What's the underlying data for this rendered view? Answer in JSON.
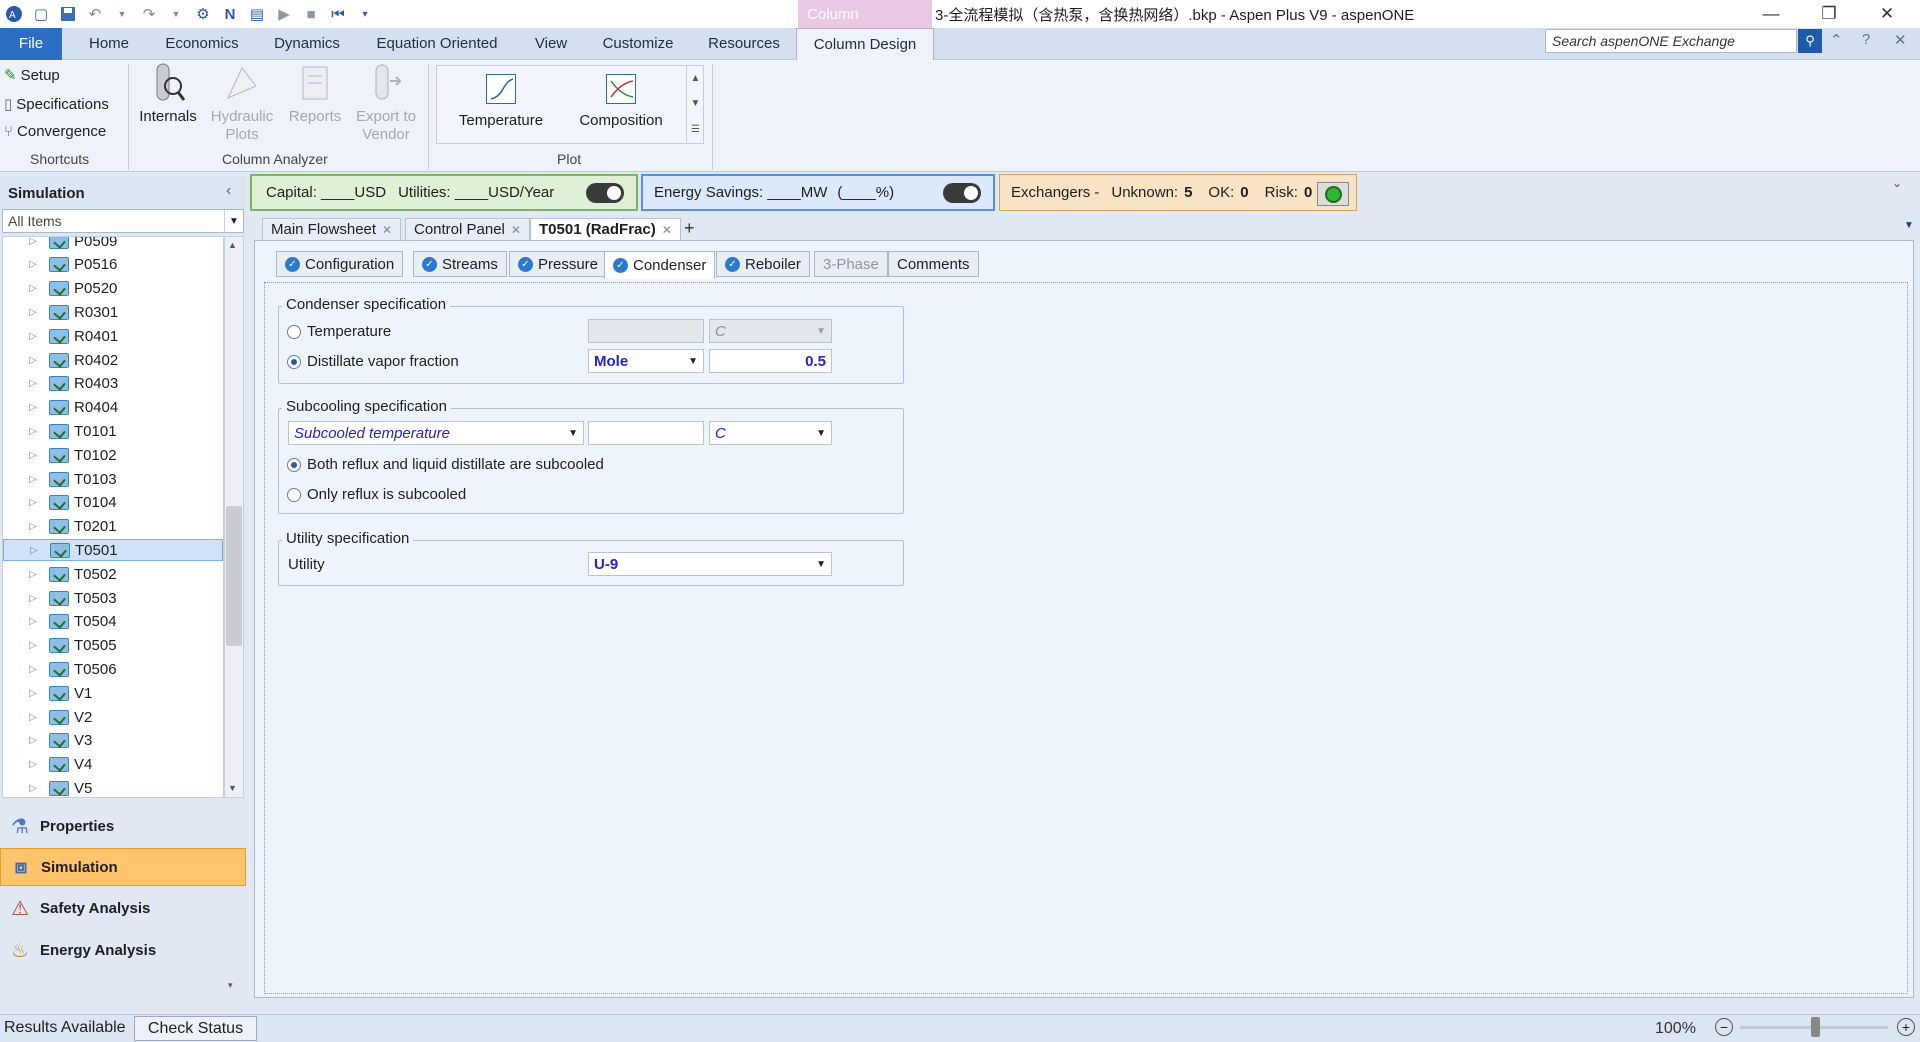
{
  "window": {
    "title": "3-全流程模拟（含热泵，含换热网络）.bkp - Aspen Plus V9 - aspenONE",
    "context_tab_header": "Column"
  },
  "ribbon": {
    "tabs": [
      "File",
      "Home",
      "Economics",
      "Dynamics",
      "Equation Oriented",
      "View",
      "Customize",
      "Resources",
      "Column Design"
    ],
    "active_tab": "Column Design",
    "search_placeholder": "Search aspenONE Exchange",
    "shortcuts": {
      "label": "Shortcuts",
      "items": [
        "Setup",
        "Specifications",
        "Convergence"
      ]
    },
    "column_analyzer": {
      "label": "Column Analyzer",
      "internals": "Internals",
      "hydraulic_plots": [
        "Hydraulic",
        "Plots"
      ],
      "reports": "Reports",
      "export": [
        "Export to",
        "Vendor"
      ]
    },
    "plot": {
      "label": "Plot",
      "temperature": "Temperature",
      "composition": "Composition"
    }
  },
  "navigator": {
    "title": "Simulation",
    "filter": "All Items",
    "tree": [
      "P0509",
      "P0516",
      "P0520",
      "R0301",
      "R0401",
      "R0402",
      "R0403",
      "R0404",
      "T0101",
      "T0102",
      "T0103",
      "T0104",
      "T0201",
      "T0501",
      "T0502",
      "T0503",
      "T0504",
      "T0505",
      "T0506",
      "V1",
      "V2",
      "V3",
      "V4",
      "V5"
    ],
    "selected": "T0501",
    "panes": [
      "Properties",
      "Simulation",
      "Safety Analysis",
      "Energy Analysis"
    ],
    "active_pane": "Simulation"
  },
  "infobar": {
    "capital": "Capital: ____USD",
    "utilities": "Utilities: ____USD/Year",
    "energy": "Energy Savings: ____MW",
    "energy_pct": "(____%)",
    "exch_label": "Exchangers -",
    "unknown_label": "Unknown:",
    "unknown_val": "5",
    "ok_label": "OK:",
    "ok_val": "0",
    "risk_label": "Risk:",
    "risk_val": "0"
  },
  "doc_tabs": [
    "Main Flowsheet",
    "Control Panel",
    "T0501 (RadFrac)"
  ],
  "active_doc_tab": "T0501 (RadFrac)",
  "form_tabs": [
    "Configuration",
    "Streams",
    "Pressure",
    "Condenser",
    "Reboiler",
    "3-Phase",
    "Comments"
  ],
  "active_form_tab": "Condenser",
  "condenser": {
    "legend": "Condenser specification",
    "temperature_label": "Temperature",
    "temperature_unit": "C",
    "dvf_label": "Distillate vapor fraction",
    "dvf_basis": "Mole",
    "dvf_value": "0.5",
    "selected": "Distillate vapor fraction"
  },
  "subcooling": {
    "legend": "Subcooling specification",
    "type": "Subcooled temperature",
    "value": "",
    "unit": "C",
    "opt1": "Both reflux and liquid distillate are subcooled",
    "opt2": "Only reflux is subcooled",
    "selected": "Both reflux and liquid distillate are subcooled"
  },
  "utility": {
    "legend": "Utility specification",
    "label": "Utility",
    "value": "U-9"
  },
  "statusbar": {
    "results": "Results Available",
    "check_status": "Check Status",
    "zoom": "100%"
  }
}
